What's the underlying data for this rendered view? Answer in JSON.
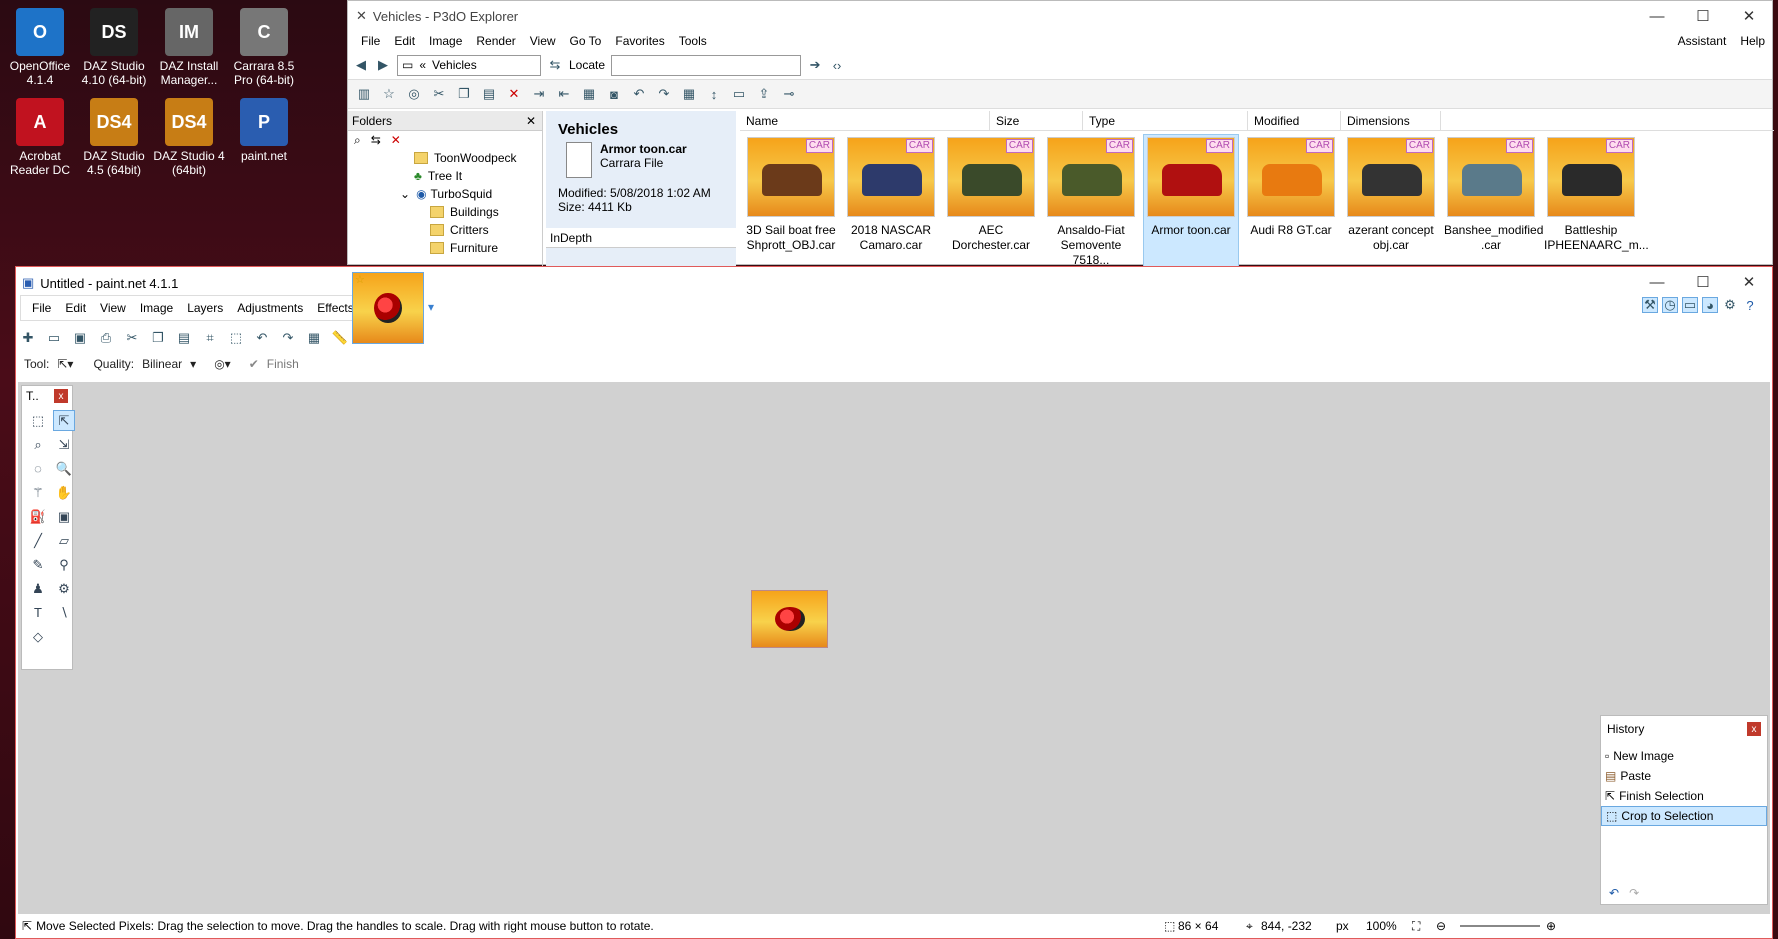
{
  "desktop": {
    "icons": [
      {
        "label1": "OpenOffice",
        "label2": "4.1.4",
        "icon": "openoffice-icon",
        "color": "#1e73c8",
        "glyph": "O"
      },
      {
        "label1": "DAZ Studio",
        "label2": "4.10 (64-bit)",
        "icon": "daz-studio-icon",
        "color": "#222",
        "glyph": "DS"
      },
      {
        "label1": "DAZ Install",
        "label2": "Manager...",
        "icon": "daz-install-icon",
        "color": "#666",
        "glyph": "IM"
      },
      {
        "label1": "Carrara 8.5",
        "label2": "Pro (64-bit)",
        "icon": "carrara-icon",
        "color": "#777",
        "glyph": "C"
      },
      {
        "label1": "Acrobat",
        "label2": "Reader DC",
        "icon": "acrobat-icon",
        "color": "#c1121f",
        "glyph": "A"
      },
      {
        "label1": "DAZ Studio",
        "label2": "4.5 (64bit)",
        "icon": "daz4-icon",
        "color": "#c77d15",
        "glyph": "DS4"
      },
      {
        "label1": "DAZ Studio 4",
        "label2": "(64bit)",
        "icon": "daz4-64-icon",
        "color": "#c77d15",
        "glyph": "DS4"
      },
      {
        "label1": "paint.net",
        "label2": "",
        "icon": "paintnet-icon",
        "color": "#2a5db0",
        "glyph": "P"
      }
    ]
  },
  "p3do": {
    "title": "Vehicles - P3dO Explorer",
    "menu": [
      "File",
      "Edit",
      "Image",
      "Render",
      "View",
      "Go To",
      "Favorites",
      "Tools"
    ],
    "menu_right": [
      "Assistant",
      "Help"
    ],
    "address": "Vehicles",
    "address_prefix": "«",
    "locate_label": "Locate",
    "locate_value": "",
    "folders_label": "Folders",
    "tree": [
      "ToonWoodpeck",
      "Tree It",
      "TurboSquid",
      "Buildings",
      "Critters",
      "Furniture"
    ],
    "info": {
      "heading": "Vehicles",
      "file": "Armor toon.car",
      "type": "Carrara File",
      "modified": "Modified: 5/08/2018 1:02 AM",
      "size": "Size: 4411 Kb",
      "panel": "InDepth"
    },
    "columns": [
      "Name",
      "Size",
      "Type",
      "Modified",
      "Dimensions"
    ],
    "thumbs": [
      {
        "l1": "3D Sail boat free",
        "l2": "Shprott_OBJ.car",
        "badge": "CAR",
        "shape": "#6b3a1a"
      },
      {
        "l1": "2018 NASCAR",
        "l2": "Camaro.car",
        "badge": "CAR",
        "shape": "#2d3a6b"
      },
      {
        "l1": "AEC",
        "l2": "Dorchester.car",
        "badge": "CAR",
        "shape": "#3a4a2a"
      },
      {
        "l1": "Ansaldo-Fiat",
        "l2": "Semovente 7518...",
        "badge": "CAR",
        "shape": "#4a5a2a"
      },
      {
        "l1": "Armor toon.car",
        "l2": "",
        "badge": "CAR",
        "shape": "#b01010"
      },
      {
        "l1": "Audi R8 GT.car",
        "l2": "",
        "badge": "CAR",
        "shape": "#e87a10"
      },
      {
        "l1": "azerant concept",
        "l2": "obj.car",
        "badge": "CAR",
        "shape": "#333"
      },
      {
        "l1": "Banshee_modified",
        "l2": ".car",
        "badge": "CAR",
        "shape": "#5a7a8a"
      },
      {
        "l1": "Battleship",
        "l2": "IPHEENAARC_m...",
        "badge": "CAR",
        "shape": "#2a2a2a"
      }
    ]
  },
  "paint": {
    "title": "Untitled - paint.net 4.1.1",
    "menu": [
      "File",
      "Edit",
      "View",
      "Image",
      "Layers",
      "Adjustments",
      "Effects"
    ],
    "tool_label": "Tool:",
    "quality_label": "Quality:",
    "quality_value": "Bilinear",
    "finish_label": "Finish",
    "toolbox_title": "T..",
    "history_title": "History",
    "history": [
      "New Image",
      "Paste",
      "Finish Selection",
      "Crop to Selection"
    ],
    "status_text": "Move Selected Pixels: Drag the selection to move. Drag the handles to scale. Drag with right mouse button to rotate.",
    "image_size": "86 × 64",
    "cursor_pos": "844, -232",
    "unit": "px",
    "zoom": "100%"
  }
}
